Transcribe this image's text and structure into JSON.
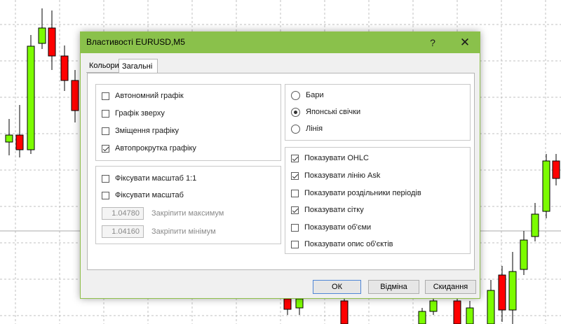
{
  "window": {
    "title": "Властивості EURUSD,M5",
    "help_label": "?",
    "close_icon": "close-icon"
  },
  "tabs": [
    {
      "label": "Кольори",
      "active": false
    },
    {
      "label": "Загальні",
      "active": true
    }
  ],
  "chart_options": [
    {
      "label": "Автономний графік",
      "checked": false
    },
    {
      "label": "Графік зверху",
      "checked": false
    },
    {
      "label": "Зміщення графіку",
      "checked": false
    },
    {
      "label": "Автопрокрутка графіку",
      "checked": true
    }
  ],
  "scale_options": [
    {
      "label": "Фіксувати масштаб 1:1",
      "checked": false
    },
    {
      "label": "Фіксувати масштаб",
      "checked": false
    }
  ],
  "scale_limits": {
    "max": {
      "value": "1.04780",
      "label": "Закріпити максимум"
    },
    "min": {
      "value": "1.04160",
      "label": "Закріпити мінімум"
    }
  },
  "chart_type": [
    {
      "label": "Бари",
      "selected": false
    },
    {
      "label": "Японські свічки",
      "selected": true
    },
    {
      "label": "Лінія",
      "selected": false
    }
  ],
  "display_options": [
    {
      "label": "Показувати OHLC",
      "checked": true
    },
    {
      "label": "Показувати лінію Ask",
      "checked": true
    },
    {
      "label": "Показувати роздільники періодів",
      "checked": false
    },
    {
      "label": "Показувати сітку",
      "checked": true
    },
    {
      "label": "Показувати об'єми",
      "checked": false
    },
    {
      "label": "Показувати опис об'єктів",
      "checked": false
    }
  ],
  "buttons": {
    "ok": "ОК",
    "cancel": "Відміна",
    "reset": "Скидання"
  },
  "colors": {
    "accent": "#8ac14b",
    "bull": "#7cfc00",
    "bear": "#ff0000"
  }
}
